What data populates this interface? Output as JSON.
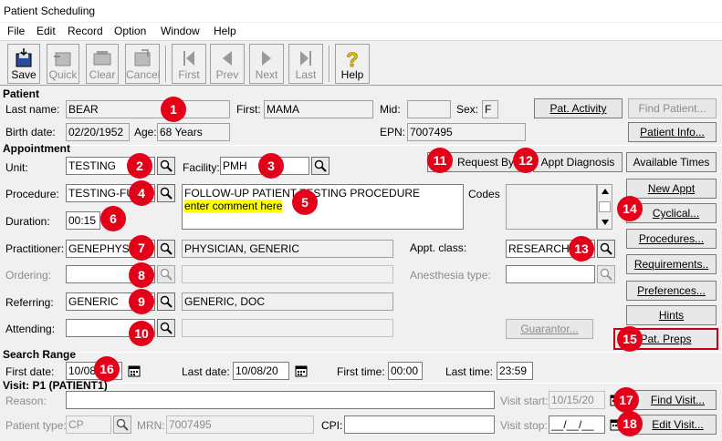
{
  "window": {
    "title": "Patient Scheduling"
  },
  "menu": [
    "File",
    "Edit",
    "Record",
    "Option",
    "Window",
    "Help"
  ],
  "toolbar": {
    "save": "Save",
    "quick": "Quick",
    "clear": "Clear",
    "cancel": "Cancel",
    "first": "First",
    "prev": "Prev",
    "next": "Next",
    "last": "Last",
    "help": "Help"
  },
  "patient": {
    "section": "Patient",
    "last_name_label": "Last name:",
    "last_name": "BEAR",
    "first_label": "First:",
    "first": "MAMA",
    "mid_label": "Mid:",
    "mid": "",
    "sex_label": "Sex:",
    "sex": "F",
    "pat_activity": "Pat. Activity",
    "find_patient": "Find Patient...",
    "birth_label": "Birth date:",
    "birth_date": "02/20/1952",
    "age_label": "Age:",
    "age": "68 Years",
    "epn_label": "EPN:",
    "epn": "7007495",
    "patient_info": "Patient Info..."
  },
  "appointment": {
    "section": "Appointment",
    "unit_label": "Unit:",
    "unit": "TESTING",
    "facility_label": "Facility:",
    "facility": "PMH",
    "request_by": "Request By",
    "appt_diagnosis": "Appt Diagnosis",
    "available_times": "Available Times",
    "procedure_label": "Procedure:",
    "procedure": "TESTING-FU",
    "comment_line1": "FOLLOW-UP PATIENT TESTING PROCEDURE",
    "comment_line2": "enter comment here",
    "codes_label": "Codes",
    "new_appt": "New Appt",
    "cyclical": "Cyclical...",
    "duration_label": "Duration:",
    "duration": "00:15",
    "practitioner_label": "Practitioner:",
    "practitioner": "GENEPHYS",
    "practitioner_name": "PHYSICIAN, GENERIC",
    "appt_class_label": "Appt. class:",
    "appt_class": "RESEARCH",
    "procedures": "Procedures...",
    "ordering_label": "Ordering:",
    "ordering": "",
    "ordering_name": "",
    "anesthesia_label": "Anesthesia type:",
    "anesthesia": "",
    "requirements": "Requirements..",
    "referring_label": "Referring:",
    "referring": "GENERIC",
    "referring_name": "GENERIC, DOC",
    "preferences": "Preferences...",
    "attending_label": "Attending:",
    "attending": "",
    "attending_name": "",
    "guarantor": "Guarantor...",
    "hints": "Hints",
    "pat_preps": "Pat. Preps"
  },
  "search": {
    "section": "Search Range",
    "first_date_label": "First date:",
    "first_date": "10/08/",
    "last_date_label": "Last date:",
    "last_date": "10/08/20",
    "first_time_label": "First time:",
    "first_time": "00:00",
    "last_time_label": "Last time:",
    "last_time": "23:59"
  },
  "visit": {
    "section": "Visit: P1 (PATIENT1)",
    "reason_label": "Reason:",
    "reason": "",
    "visit_start_label": "Visit start:",
    "visit_start": "10/15/20",
    "find_visit": "Find Visit...",
    "patient_type_label": "Patient type:",
    "patient_type": "CP",
    "mrn_label": "MRN:",
    "mrn": "7007495",
    "cpi_label": "CPI:",
    "cpi": "",
    "visit_stop_label": "Visit stop:",
    "visit_stop": "__/__/__",
    "edit_visit": "Edit Visit..."
  },
  "badges": [
    "1",
    "2",
    "3",
    "4",
    "5",
    "6",
    "7",
    "8",
    "9",
    "10",
    "11",
    "12",
    "13",
    "14",
    "15",
    "16",
    "17",
    "18"
  ],
  "colors": {
    "badge": "#e5001a",
    "highlight": "#ffff00",
    "focus_border": "#c0001a"
  }
}
